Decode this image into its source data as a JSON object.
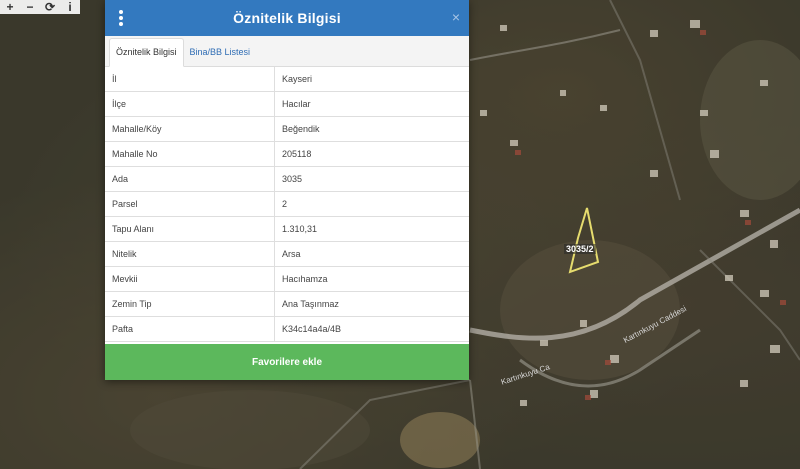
{
  "map": {
    "road_labels": [
      "Kartınkuyu Caddesi",
      "Kartınkuyu Ca"
    ],
    "parcel_label": "3035/2",
    "parcel_color": "#e6dc6e"
  },
  "toolbar": {
    "zoom_in": "+",
    "zoom_out": "−",
    "refresh": "⟳",
    "info": "i"
  },
  "dialog": {
    "title": "Öznitelik Bilgisi",
    "close": "×",
    "tabs": [
      {
        "label": "Öznitelik Bilgisi",
        "active": true
      },
      {
        "label": "Bina/BB Listesi",
        "active": false
      }
    ],
    "rows": [
      {
        "key": "İl",
        "value": "Kayseri"
      },
      {
        "key": "İlçe",
        "value": "Hacılar"
      },
      {
        "key": "Mahalle/Köy",
        "value": "Beğendik"
      },
      {
        "key": "Mahalle No",
        "value": "205118"
      },
      {
        "key": "Ada",
        "value": "3035"
      },
      {
        "key": "Parsel",
        "value": "2"
      },
      {
        "key": "Tapu Alanı",
        "value": "1.310,31"
      },
      {
        "key": "Nitelik",
        "value": "Arsa"
      },
      {
        "key": "Mevkii",
        "value": "Hacıhamza"
      },
      {
        "key": "Zemin Tip",
        "value": "Ana Taşınmaz"
      },
      {
        "key": "Pafta",
        "value": "K34c14a4a/4B"
      }
    ],
    "favorite_button": "Favorilere ekle"
  },
  "colors": {
    "header": "#3379bf",
    "favorite": "#5cb85c"
  }
}
